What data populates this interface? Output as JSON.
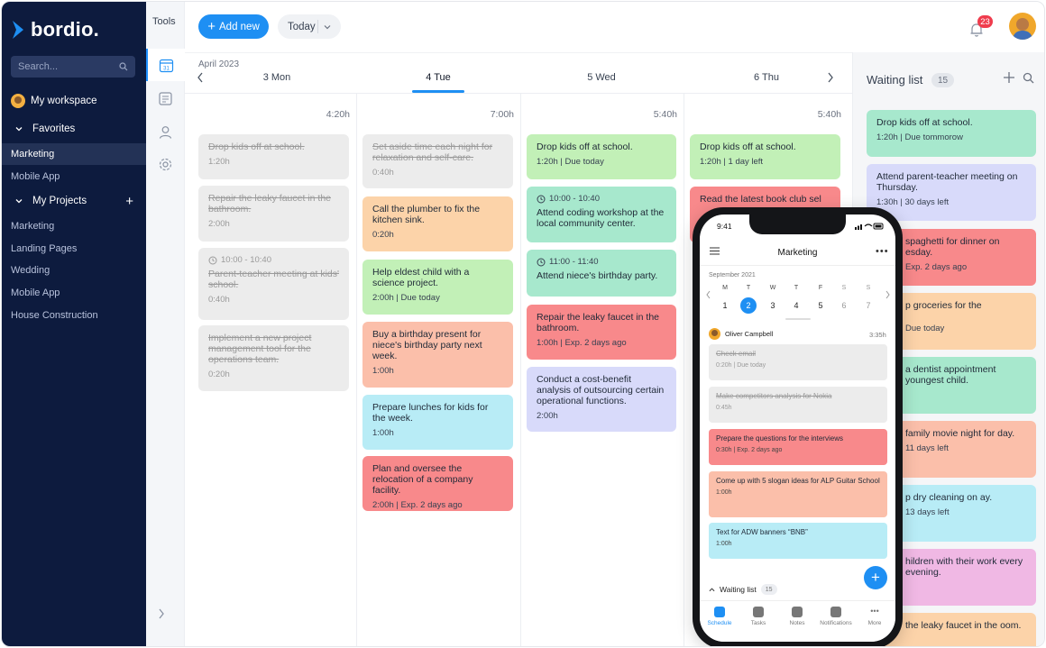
{
  "sidebar": {
    "brand": "bordio.",
    "search_placeholder": "Search...",
    "workspace": "My workspace",
    "favorites_label": "Favorites",
    "favorites": [
      "Marketing",
      "Mobile App"
    ],
    "projects_label": "My Projects",
    "projects": [
      "Marketing",
      "Landing Pages",
      "Wedding",
      "Mobile App",
      "House Construction"
    ]
  },
  "tools": {
    "title": "Tools",
    "calendar_day": "31"
  },
  "header": {
    "add_label": "Add new",
    "today_label": "Today",
    "notification_count": "23"
  },
  "calendar": {
    "month": "April 2023",
    "days": [
      {
        "label": "3 Mon",
        "total": "4:20h"
      },
      {
        "label": "4 Tue",
        "total": "7:00h"
      },
      {
        "label": "5 Wed",
        "total": "5:40h"
      },
      {
        "label": "6 Thu",
        "total": "5:40h"
      }
    ],
    "columns": [
      [
        {
          "title": "Drop kids off at school.",
          "meta": "1:20h",
          "done": true
        },
        {
          "title": "Repair the leaky faucet in the bathroom.",
          "meta": "2:00h",
          "done": true
        },
        {
          "time": "10:00 - 10:40",
          "title": "Parent-teacher meeting at kids' school.",
          "meta": "0:40h",
          "done": true
        },
        {
          "title": "Implement a new project management tool for the operations team.",
          "meta": "0:20h",
          "done": true
        }
      ],
      [
        {
          "title": "Set aside time each night for relaxation and self-care.",
          "meta": "0:40h",
          "done": true
        },
        {
          "title": "Call the plumber to fix the kitchen sink.",
          "meta": "0:20h"
        },
        {
          "title": "Help eldest child with a science project.",
          "meta": "2:00h | Due today"
        },
        {
          "title": "Buy a birthday present for niece's birthday party next week.",
          "meta": "1:00h"
        },
        {
          "title": "Prepare lunches for kids for the week.",
          "meta": "1:00h"
        },
        {
          "title": "Plan and oversee the relocation of a company facility.",
          "meta": "2:00h | Exp. 2 days ago"
        }
      ],
      [
        {
          "title": "Drop kids off at school.",
          "meta": "1:20h | Due today"
        },
        {
          "time": "10:00 - 10:40",
          "title": "Attend coding workshop at the local community center."
        },
        {
          "time": "11:00 - 11:40",
          "title": "Attend niece's birthday party."
        },
        {
          "title": "Repair the leaky faucet in the bathroom.",
          "meta": "1:00h | Exp. 2 days ago"
        },
        {
          "title": "Conduct a cost-benefit analysis of outsourcing certain operational functions.",
          "meta": "2:00h"
        }
      ],
      [
        {
          "title": "Drop kids off at school.",
          "meta": "1:20h | 1 day left"
        },
        {
          "title": "Read the latest book club sel"
        }
      ]
    ]
  },
  "waiting": {
    "title": "Waiting list",
    "count": "15",
    "items": [
      {
        "title": "Drop kids off at school.",
        "meta": "1:20h | Due tommorow"
      },
      {
        "title": "Attend parent-teacher meeting on Thursday.",
        "meta": "1:30h | 30 days left"
      },
      {
        "title": "spaghetti for dinner on esday.",
        "meta": "Exp. 2 days ago"
      },
      {
        "title": "p groceries for the",
        "meta": "Due today"
      },
      {
        "title": "a dentist appointment youngest child.",
        "meta": ""
      },
      {
        "title": "family movie night for day.",
        "meta": "11 days left"
      },
      {
        "title": "p dry cleaning on ay.",
        "meta": "13 days left"
      },
      {
        "title": "hildren with their work every evening.",
        "meta": ""
      },
      {
        "title": "the leaky faucet in the oom.",
        "meta": ""
      }
    ]
  },
  "phone": {
    "time": "9:41",
    "title": "Marketing",
    "month": "September 2021",
    "weekdays": [
      "M",
      "T",
      "W",
      "T",
      "F",
      "S",
      "S"
    ],
    "dates": [
      "1",
      "2",
      "3",
      "4",
      "5",
      "6",
      "7"
    ],
    "user": "Oliver Campbell",
    "user_total": "3:35h",
    "cards": [
      {
        "title": "Check email",
        "meta": "0:20h | Due today",
        "done": true
      },
      {
        "title": "Make competitors analysis for Nokia",
        "meta": "0:45h",
        "done": true
      },
      {
        "title": "Prepare the questions for the interviews",
        "meta": "0:30h | Exp. 2 days ago"
      },
      {
        "title": "Come up with 5 slogan ideas for ALP Guitar School",
        "meta": "1:00h"
      },
      {
        "title": "Text for ADW banners “BNB”",
        "meta": "1:00h"
      }
    ],
    "waiting_label": "Waiting list",
    "waiting_count": "15",
    "tabs": [
      "Schedule",
      "Tasks",
      "Notes",
      "Notifications",
      "More"
    ]
  },
  "colors": {
    "accent": "#1e8ff3",
    "sidebar": "#0d1b3e",
    "badge": "#ef3c4d"
  }
}
